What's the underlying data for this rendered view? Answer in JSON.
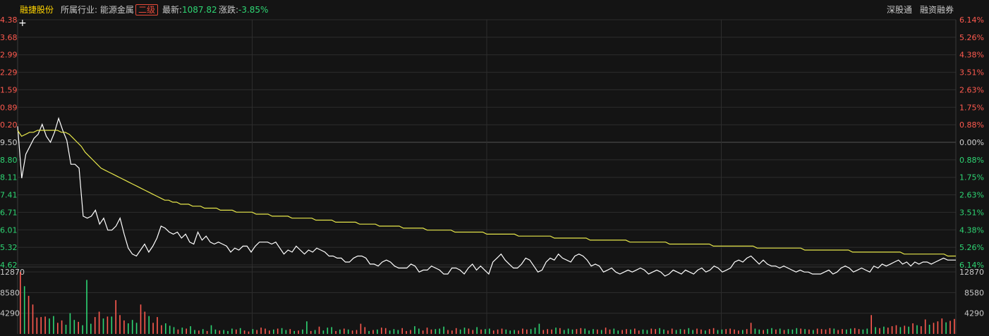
{
  "header": {
    "stock_name": "融捷股份",
    "industry_label": "所属行业:",
    "industry_value": "能源金属",
    "industry_level": "二级",
    "latest_label": "最新:",
    "latest_value": "1087.82",
    "change_label": "涨跌:",
    "change_value": "-3.85%",
    "right_link_1": "深股通",
    "right_link_2": "融资融券"
  },
  "colors": {
    "background": "#141414",
    "grid": "#2d2d2d",
    "zero_line": "#555555",
    "up": "#ff5a4f",
    "down": "#2ed573",
    "price_line": "#ffffff",
    "avg_line": "#e6e64a",
    "name_color": "#ffd400"
  },
  "icons": {
    "crosshair": "+"
  },
  "chart_data": [
    {
      "type": "line",
      "title": "",
      "left_axis_labels": [
        "4.38",
        "3.68",
        "2.99",
        "2.29",
        "1.59",
        "0.89",
        "0.20",
        "9.50",
        "8.80",
        "8.11",
        "7.41",
        "6.71",
        "6.01",
        "5.32",
        "4.62"
      ],
      "right_axis_labels": [
        "6.14%",
        "5.26%",
        "4.38%",
        "3.51%",
        "2.63%",
        "1.75%",
        "0.88%",
        "0.00%",
        "0.88%",
        "1.75%",
        "2.63%",
        "3.51%",
        "4.38%",
        "5.26%",
        "6.14%"
      ],
      "pct_range": [
        -6.14,
        6.14
      ],
      "grid": true,
      "series": [
        {
          "kind": "price",
          "values_pct": [
            0.8,
            -1.8,
            -0.6,
            -0.2,
            0.2,
            0.4,
            0.9,
            0.3,
            0.0,
            0.5,
            1.2,
            0.6,
            0.1,
            -1.1,
            -1.1,
            -1.3,
            -3.7,
            -3.8,
            -3.7,
            -3.4,
            -4.1,
            -3.8,
            -4.4,
            -4.4,
            -4.2,
            -3.8,
            -4.6,
            -5.3,
            -5.6,
            -5.7,
            -5.4,
            -5.1,
            -5.5,
            -5.2,
            -4.8,
            -4.2,
            -4.3,
            -4.5,
            -4.6,
            -4.5,
            -4.8,
            -4.6,
            -5.0,
            -5.1,
            -4.5,
            -4.9,
            -4.7,
            -5.0,
            -5.1,
            -5.0,
            -5.1,
            -5.2,
            -5.5,
            -5.3,
            -5.4,
            -5.2,
            -5.2,
            -5.5,
            -5.2,
            -5.0,
            -5.0,
            -5.0,
            -5.1,
            -5.0,
            -5.3,
            -5.6,
            -5.4,
            -5.5,
            -5.2,
            -5.4,
            -5.6,
            -5.4,
            -5.5,
            -5.3,
            -5.4,
            -5.5,
            -5.7,
            -5.7,
            -5.8,
            -5.8,
            -6.0,
            -6.0,
            -5.8,
            -5.7,
            -5.7,
            -5.8,
            -6.1,
            -6.1,
            -6.2,
            -6.0,
            -5.9,
            -6.0,
            -6.2,
            -6.3,
            -6.3,
            -6.3,
            -6.1,
            -6.2,
            -6.5,
            -6.4,
            -6.4,
            -6.2,
            -6.3,
            -6.4,
            -6.6,
            -6.6,
            -6.3,
            -6.3,
            -6.4,
            -6.6,
            -6.3,
            -6.1,
            -6.4,
            -6.2,
            -6.4,
            -6.6,
            -6.0,
            -5.8,
            -5.6,
            -5.9,
            -6.1,
            -6.3,
            -6.3,
            -6.1,
            -5.8,
            -5.9,
            -6.2,
            -6.5,
            -6.4,
            -6.0,
            -5.8,
            -5.9,
            -5.6,
            -5.8,
            -5.9,
            -6.0,
            -5.7,
            -5.6,
            -5.7,
            -5.9,
            -6.2,
            -6.1,
            -6.2,
            -6.5,
            -6.4,
            -6.3,
            -6.5,
            -6.6,
            -6.5,
            -6.4,
            -6.5,
            -6.4,
            -6.3,
            -6.4,
            -6.6,
            -6.5,
            -6.4,
            -6.5,
            -6.7,
            -6.6,
            -6.4,
            -6.5,
            -6.6,
            -6.4,
            -6.5,
            -6.6,
            -6.4,
            -6.3,
            -6.5,
            -6.4,
            -6.2,
            -6.3,
            -6.5,
            -6.4,
            -6.3,
            -6.0,
            -5.9,
            -6.0,
            -5.8,
            -5.7,
            -5.9,
            -6.1,
            -5.9,
            -6.1,
            -6.2,
            -6.2,
            -6.3,
            -6.2,
            -6.3,
            -6.4,
            -6.5,
            -6.4,
            -6.5,
            -6.5,
            -6.6,
            -6.6,
            -6.6,
            -6.5,
            -6.4,
            -6.6,
            -6.5,
            -6.3,
            -6.2,
            -6.3,
            -6.5,
            -6.4,
            -6.3,
            -6.4,
            -6.5,
            -6.2,
            -6.3,
            -6.1,
            -6.2,
            -6.1,
            -6.0,
            -5.9,
            -6.1,
            -6.0,
            -6.2,
            -6.0,
            -6.1,
            -6.0,
            -6.0,
            -6.1,
            -6.0,
            -5.9,
            -5.8,
            -5.9,
            -5.9,
            -5.9
          ]
        },
        {
          "kind": "average",
          "values_pct": [
            0.6,
            0.3,
            0.4,
            0.5,
            0.5,
            0.6,
            0.6,
            0.6,
            0.6,
            0.6,
            0.6,
            0.5,
            0.5,
            0.4,
            0.2,
            0.0,
            -0.2,
            -0.5,
            -0.7,
            -0.9,
            -1.1,
            -1.3,
            -1.4,
            -1.5,
            -1.6,
            -1.7,
            -1.8,
            -1.9,
            -2.0,
            -2.1,
            -2.2,
            -2.3,
            -2.4,
            -2.5,
            -2.6,
            -2.7,
            -2.8,
            -2.9,
            -2.9,
            -3.0,
            -3.0,
            -3.1,
            -3.1,
            -3.1,
            -3.2,
            -3.2,
            -3.2,
            -3.3,
            -3.3,
            -3.3,
            -3.3,
            -3.4,
            -3.4,
            -3.4,
            -3.4,
            -3.5,
            -3.5,
            -3.5,
            -3.5,
            -3.5,
            -3.6,
            -3.6,
            -3.6,
            -3.6,
            -3.7,
            -3.7,
            -3.7,
            -3.7,
            -3.7,
            -3.8,
            -3.8,
            -3.8,
            -3.8,
            -3.8,
            -3.8,
            -3.9,
            -3.9,
            -3.9,
            -3.9,
            -3.9,
            -4.0,
            -4.0,
            -4.0,
            -4.0,
            -4.0,
            -4.0,
            -4.1,
            -4.1,
            -4.1,
            -4.1,
            -4.1,
            -4.2,
            -4.2,
            -4.2,
            -4.2,
            -4.2,
            -4.2,
            -4.3,
            -4.3,
            -4.3,
            -4.3,
            -4.3,
            -4.3,
            -4.4,
            -4.4,
            -4.4,
            -4.4,
            -4.4,
            -4.4,
            -4.4,
            -4.5,
            -4.5,
            -4.5,
            -4.5,
            -4.5,
            -4.5,
            -4.5,
            -4.5,
            -4.6,
            -4.6,
            -4.6,
            -4.6,
            -4.6,
            -4.6,
            -4.6,
            -4.6,
            -4.7,
            -4.7,
            -4.7,
            -4.7,
            -4.7,
            -4.7,
            -4.7,
            -4.7,
            -4.7,
            -4.8,
            -4.8,
            -4.8,
            -4.8,
            -4.8,
            -4.8,
            -4.8,
            -4.8,
            -4.8,
            -4.9,
            -4.9,
            -4.9,
            -4.9,
            -4.9,
            -4.9,
            -4.9,
            -4.9,
            -4.9,
            -4.9,
            -5.0,
            -5.0,
            -5.0,
            -5.0,
            -5.0,
            -5.0,
            -5.0,
            -5.0,
            -5.0,
            -5.0,
            -5.1,
            -5.1,
            -5.1,
            -5.1,
            -5.1,
            -5.1,
            -5.1,
            -5.1,
            -5.1,
            -5.1,
            -5.1,
            -5.2,
            -5.2,
            -5.2,
            -5.2,
            -5.2,
            -5.2,
            -5.2,
            -5.2,
            -5.2,
            -5.2,
            -5.2,
            -5.3,
            -5.3,
            -5.3,
            -5.3,
            -5.3,
            -5.3,
            -5.3,
            -5.3,
            -5.3,
            -5.3,
            -5.3,
            -5.3,
            -5.4,
            -5.4,
            -5.4,
            -5.4,
            -5.4,
            -5.4,
            -5.4,
            -5.4,
            -5.4,
            -5.4,
            -5.4,
            -5.4,
            -5.5,
            -5.5,
            -5.5,
            -5.5,
            -5.5,
            -5.5,
            -5.5,
            -5.5,
            -5.5,
            -5.5,
            -5.5,
            -5.5,
            -5.5,
            -5.6,
            -5.6,
            -5.6,
            -5.6,
            -5.6,
            -5.6,
            -5.6,
            -5.6,
            -5.6,
            -5.6,
            -5.6,
            -5.7,
            -5.7,
            -5.7
          ]
        }
      ]
    },
    {
      "type": "bar",
      "title": "",
      "left_axis_labels": [
        "12870",
        "8580",
        "4290"
      ],
      "right_axis_labels": [
        "12870",
        "8580",
        "4290"
      ],
      "ylim": [
        0,
        12870
      ],
      "volumes": [
        12870,
        9900,
        7900,
        6100,
        3400,
        3500,
        3600,
        3200,
        3700,
        2300,
        2800,
        1900,
        4300,
        2900,
        2500,
        1800,
        11200,
        2100,
        3500,
        4600,
        3200,
        3600,
        3600,
        7000,
        3900,
        2800,
        2200,
        2900,
        2300,
        6100,
        4600,
        3700,
        2300,
        3500,
        1800,
        2200,
        1700,
        1400,
        900,
        1300,
        1100,
        1600,
        800,
        700,
        1000,
        600,
        1800,
        900,
        700,
        800,
        600,
        1100,
        900,
        1200,
        700,
        500,
        1000,
        800,
        1300,
        1100,
        700,
        900,
        1100,
        1200,
        800,
        1000,
        600,
        700,
        900,
        2600,
        600,
        800,
        1500,
        700,
        1300,
        1400,
        600,
        900,
        1100,
        900,
        700,
        800,
        2100,
        1400,
        600,
        800,
        900,
        1300,
        1200,
        700,
        1000,
        800,
        1200,
        600,
        800,
        1600,
        1100,
        700,
        1300,
        900,
        1000,
        1100,
        1500,
        800,
        700,
        1200,
        900,
        1300,
        1100,
        800,
        1400,
        900,
        1000,
        1100,
        700,
        900,
        1100,
        900,
        700,
        800,
        700,
        1100,
        900,
        1000,
        1300,
        2100,
        800,
        1000,
        900,
        1300,
        1200,
        800,
        1100,
        900,
        1000,
        1200,
        1100,
        700,
        1000,
        900,
        800,
        1300,
        900,
        1100,
        700,
        800,
        1000,
        900,
        1100,
        700,
        900,
        800,
        1100,
        1000,
        1200,
        900,
        700,
        1100,
        800,
        1000,
        900,
        1200,
        800,
        1100,
        900,
        700,
        1000,
        1200,
        800,
        900,
        1000,
        1100,
        900,
        700,
        800,
        1000,
        2300,
        1100,
        900,
        800,
        1000,
        1200,
        900,
        1100,
        800,
        1000,
        900,
        1200,
        1100,
        1000,
        900,
        800,
        1100,
        1000,
        900,
        1200,
        1100,
        800,
        1000,
        900,
        1100,
        1200,
        1000,
        900,
        1100,
        3900,
        1400,
        1200,
        1500,
        1300,
        1600,
        1800,
        1400,
        1700,
        1500,
        2200,
        1800,
        1600,
        3000,
        1900,
        2300,
        2600,
        3200,
        2400,
        2700,
        3100
      ]
    }
  ]
}
